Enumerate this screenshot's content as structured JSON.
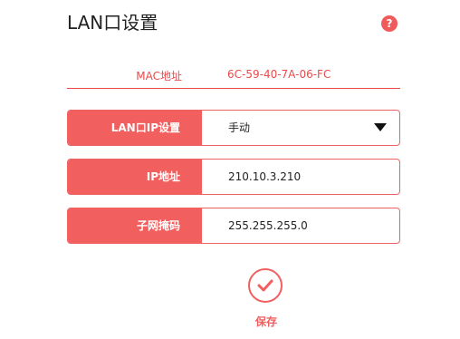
{
  "header": {
    "title": "LAN口设置",
    "help_icon": "question-circle-icon"
  },
  "mac": {
    "label": "MAC地址",
    "value": "6C-59-40-7A-06-FC"
  },
  "fields": [
    {
      "label": "LAN口IP设置",
      "value": "手动",
      "control": "dropdown"
    },
    {
      "label": "IP地址",
      "value": "210.10.3.210",
      "control": "input"
    },
    {
      "label": "子网掩码",
      "value": "255.255.255.0",
      "control": "input"
    }
  ],
  "save": {
    "label": "保存",
    "icon": "checkmark-circle-icon"
  },
  "colors": {
    "accent": "#f25f5f",
    "mac_text": "#e94b4b",
    "title_text": "#222222"
  }
}
